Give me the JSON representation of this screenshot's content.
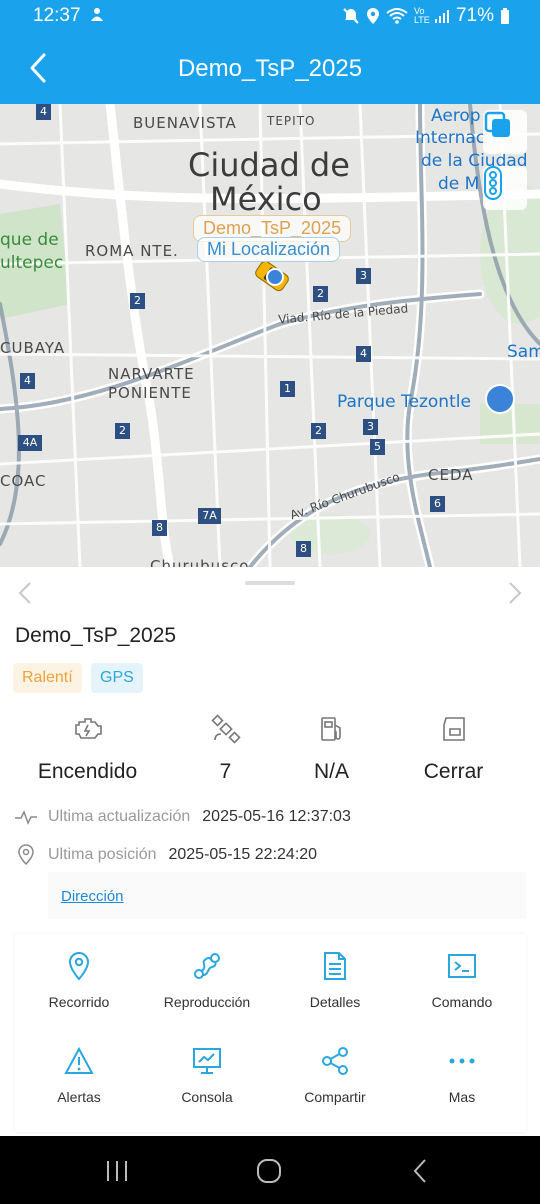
{
  "status_bar": {
    "time": "12:37",
    "network_label": "Vo LTE",
    "battery": "71%"
  },
  "header": {
    "title": "Demo_TsP_2025"
  },
  "map": {
    "labels": {
      "buenavista": "BUENAVISTA",
      "tepito": "TEPITO",
      "city_line1": "Ciudad de",
      "city_line2": "México",
      "roma": "ROMA NTE.",
      "bosque1": "que de",
      "bosque2": "ultepec",
      "tacubaya": "CUBAYA",
      "narvarte1": "NARVARTE",
      "narvarte2": "PONIENTE",
      "coac": "COAC",
      "ceda": "CEDA",
      "churubusco_partial": "Churubusco",
      "viaduct": "Viad. Río de la Piedad",
      "rio_churubusco": "Av. Río Churubusco",
      "airport1": "Aerop",
      "airport2": "Internac",
      "airport3": "de la Ciudad",
      "airport4": "de M",
      "parque": "Parque Tezontle",
      "sam": "Sam"
    },
    "route_badges": [
      "4",
      "2",
      "3",
      "2",
      "4",
      "4",
      "1",
      "2",
      "3",
      "5",
      "4A",
      "2",
      "8",
      "7A",
      "6",
      "8"
    ],
    "vehicle_tag": "Demo_TsP_2025",
    "my_location_tag": "Mi Localización"
  },
  "device": {
    "name": "Demo_TsP_2025",
    "chips": {
      "idle": "Ralentí",
      "gps": "GPS"
    },
    "metrics": {
      "engine": "Encendido",
      "satellites": "7",
      "fuel": "N/A",
      "door": "Cerrar"
    },
    "last_update_label": "Ultima actualización",
    "last_update_value": "2025-05-16 12:37:03",
    "last_position_label": "Ultima posición",
    "last_position_value": "2025-05-15 22:24:20",
    "address_link": "Dirección"
  },
  "actions": [
    {
      "label": "Recorrido",
      "icon": "location-pin-icon"
    },
    {
      "label": "Reproducción",
      "icon": "route-playback-icon"
    },
    {
      "label": "Detalles",
      "icon": "document-icon"
    },
    {
      "label": "Comando",
      "icon": "terminal-icon"
    },
    {
      "label": "Alertas",
      "icon": "warning-icon"
    },
    {
      "label": "Consola",
      "icon": "monitor-chart-icon"
    },
    {
      "label": "Compartir",
      "icon": "share-icon"
    },
    {
      "label": "Mas",
      "icon": "more-dots-icon"
    }
  ],
  "colors": {
    "brand_blue": "#1aa3ec",
    "accent_icon": "#2aa6e0",
    "idle_chip_text": "#f0a23b",
    "link": "#1c8ad8"
  }
}
